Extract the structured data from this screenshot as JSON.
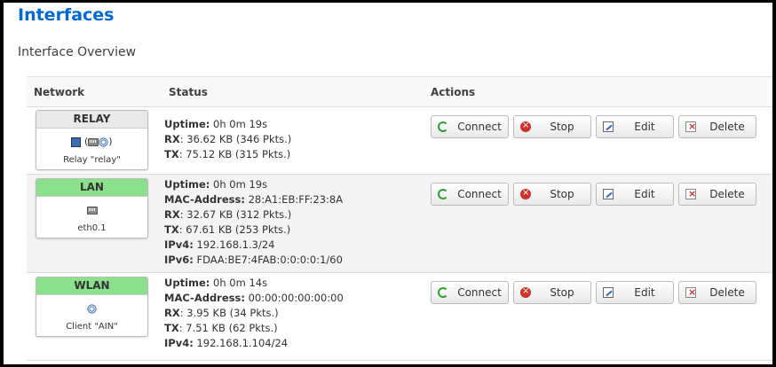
{
  "header": {
    "title": "Interfaces",
    "section": "Interface Overview"
  },
  "table": {
    "columns": {
      "network": "Network",
      "status": "Status",
      "actions": "Actions"
    },
    "rows": [
      {
        "name": "RELAY",
        "header_color": "#e9e9e9",
        "device": "Relay \"relay\"",
        "icons": [
          "bridge-icon",
          "network-icon",
          "wifi-icon"
        ],
        "status": [
          {
            "k": "Uptime:",
            "v": "0h 0m 19s"
          },
          {
            "k": "RX",
            "v": ": 36.62 KB (346 Pkts.)"
          },
          {
            "k": "TX",
            "v": ": 75.12 KB (315 Pkts.)"
          }
        ]
      },
      {
        "name": "LAN",
        "header_color": "#8be08b",
        "device": "eth0.1",
        "icons": [
          "network-icon"
        ],
        "status": [
          {
            "k": "Uptime:",
            "v": "0h 0m 19s"
          },
          {
            "k": "MAC-Address:",
            "v": "28:A1:EB:FF:23:8A"
          },
          {
            "k": "RX",
            "v": ": 32.67 KB (312 Pkts.)"
          },
          {
            "k": "TX",
            "v": ": 67.61 KB (253 Pkts.)"
          },
          {
            "k": "IPv4:",
            "v": "192.168.1.3/24"
          },
          {
            "k": "IPv6:",
            "v": "FDAA:BE7:4FAB:0:0:0:0:1/60"
          }
        ]
      },
      {
        "name": "WLAN",
        "header_color": "#8be08b",
        "device": "Client \"AIN\"",
        "icons": [
          "wifi-icon"
        ],
        "status": [
          {
            "k": "Uptime:",
            "v": "0h 0m 14s"
          },
          {
            "k": "MAC-Address:",
            "v": "00:00:00:00:00:00"
          },
          {
            "k": "RX",
            "v": ": 3.95 KB (34 Pkts.)"
          },
          {
            "k": "TX",
            "v": ": 7.51 KB (62 Pkts.)"
          },
          {
            "k": "IPv4:",
            "v": "192.168.1.104/24"
          }
        ]
      }
    ],
    "actions": {
      "connect": "Connect",
      "stop": "Stop",
      "edit": "Edit",
      "delete": "Delete"
    }
  }
}
